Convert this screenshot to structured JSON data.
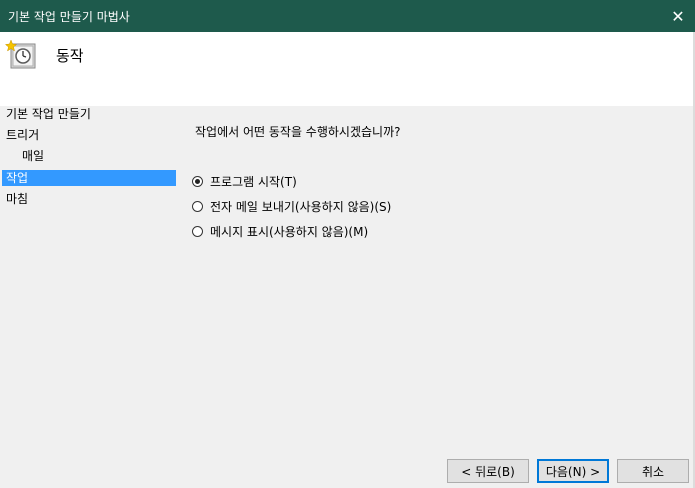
{
  "window": {
    "title": "기본 작업 만들기 마법사",
    "close_glyph": "✕"
  },
  "header": {
    "title": "동작"
  },
  "nav": {
    "items": [
      {
        "label": "기본 작업 만들기"
      },
      {
        "label": "트리거"
      },
      {
        "label": "매일"
      },
      {
        "label": "작업"
      },
      {
        "label": "마침"
      }
    ]
  },
  "main": {
    "question": "작업에서 어떤 동작을 수행하시겠습니까?",
    "options": [
      {
        "label": "프로그램 시작(T)",
        "selected": true
      },
      {
        "label": "전자 메일 보내기(사용하지 않음)(S)",
        "selected": false
      },
      {
        "label": "메시지 표시(사용하지 않음)(M)",
        "selected": false
      }
    ]
  },
  "buttons": {
    "back": "< 뒤로(B)",
    "next": "다음(N) >",
    "cancel": "취소"
  },
  "colors": {
    "titlebar": "#1e5a4c",
    "selection": "#3399ff",
    "accent": "#0078d7"
  },
  "icons": {
    "header": "task-scheduler-clock-icon"
  }
}
